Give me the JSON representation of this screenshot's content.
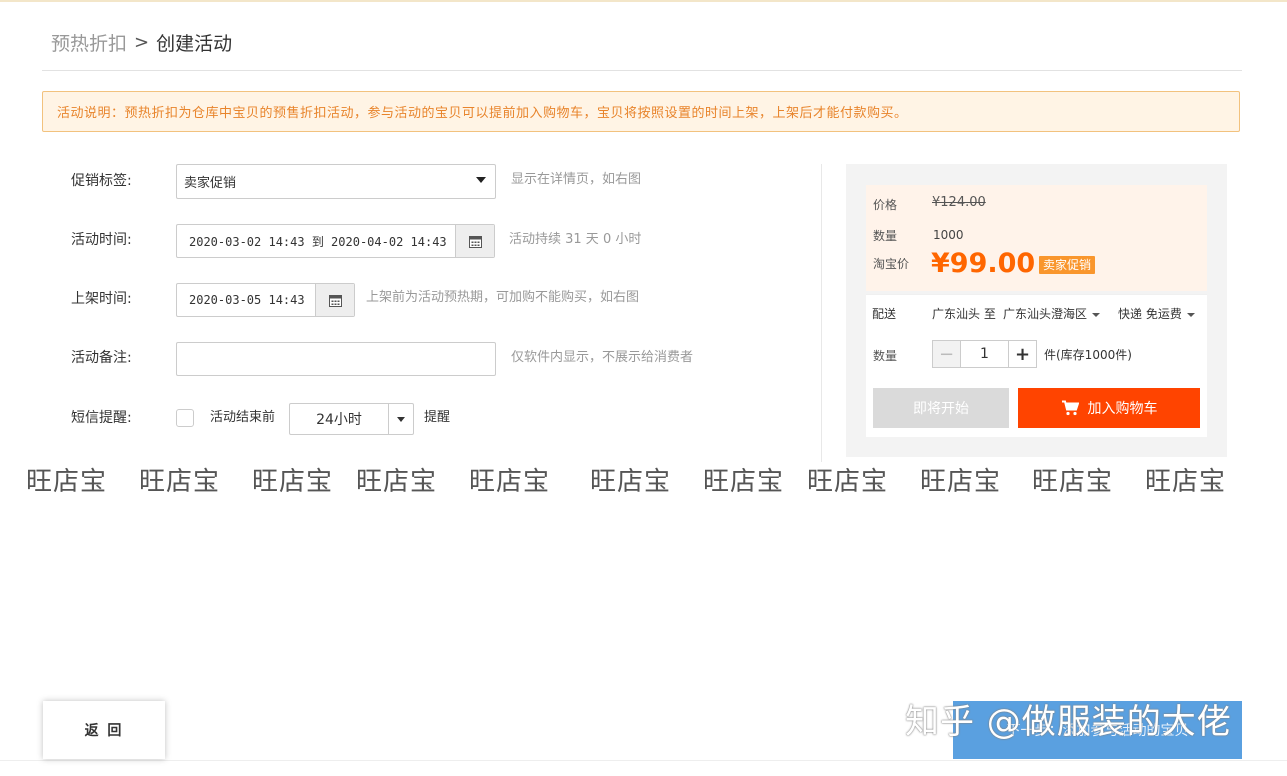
{
  "breadcrumb": {
    "parent": "预热折扣",
    "separator": ">",
    "current": "创建活动"
  },
  "notice": {
    "text": "活动说明：预热折扣为仓库中宝贝的预售折扣活动，参与活动的宝贝可以提前加入购物车，宝贝将按照设置的时间上架，上架后才能付款购买。"
  },
  "form": {
    "promo_tag": {
      "label": "促销标签:",
      "value": "卖家促销",
      "hint": "显示在详情页，如右图"
    },
    "activity_time": {
      "label": "活动时间:",
      "value": "2020-03-02 14:43 到 2020-04-02 14:43",
      "hint": "活动持续 31 天 0 小时"
    },
    "listing_time": {
      "label": "上架时间:",
      "value": "2020-03-05 14:43",
      "hint": "上架前为活动预热期，可加购不能购买，如右图"
    },
    "remark": {
      "label": "活动备注:",
      "value": "",
      "hint": "仅软件内显示，不展示给消费者"
    },
    "sms": {
      "label": "短信提醒:",
      "checkbox_label": "活动结束前",
      "checked": false,
      "hours": "24小时",
      "suffix": "提醒"
    }
  },
  "preview": {
    "price_label": "价格",
    "price_value": "¥124.00",
    "qty_label": "数量",
    "qty_value": "1000",
    "tb_price_label": "淘宝价",
    "tb_price_value": "¥99.00",
    "tb_tag": "卖家促销",
    "ship_label": "配送",
    "ship_from": "广东汕头 至",
    "ship_to": "广东汕头澄海区",
    "ship_method": "快递 免运费",
    "buy_qty_label": "数量",
    "buy_qty_value": "1",
    "stock_text": "件(库存1000件)",
    "btn_soon": "即将开始",
    "btn_cart": "加入购物车"
  },
  "watermark": {
    "text": "旺店宝",
    "count": 11
  },
  "footer": {
    "back_label": "返 回",
    "next_label": "下一步：添加参与活动的宝贝"
  },
  "overlay_watermark": "知乎 @做服装的大佬",
  "colors": {
    "accent_orange": "#ff4400",
    "price_orange": "#ff6600",
    "notice_text": "#e8842b",
    "primary_blue": "#5aa0e0"
  }
}
